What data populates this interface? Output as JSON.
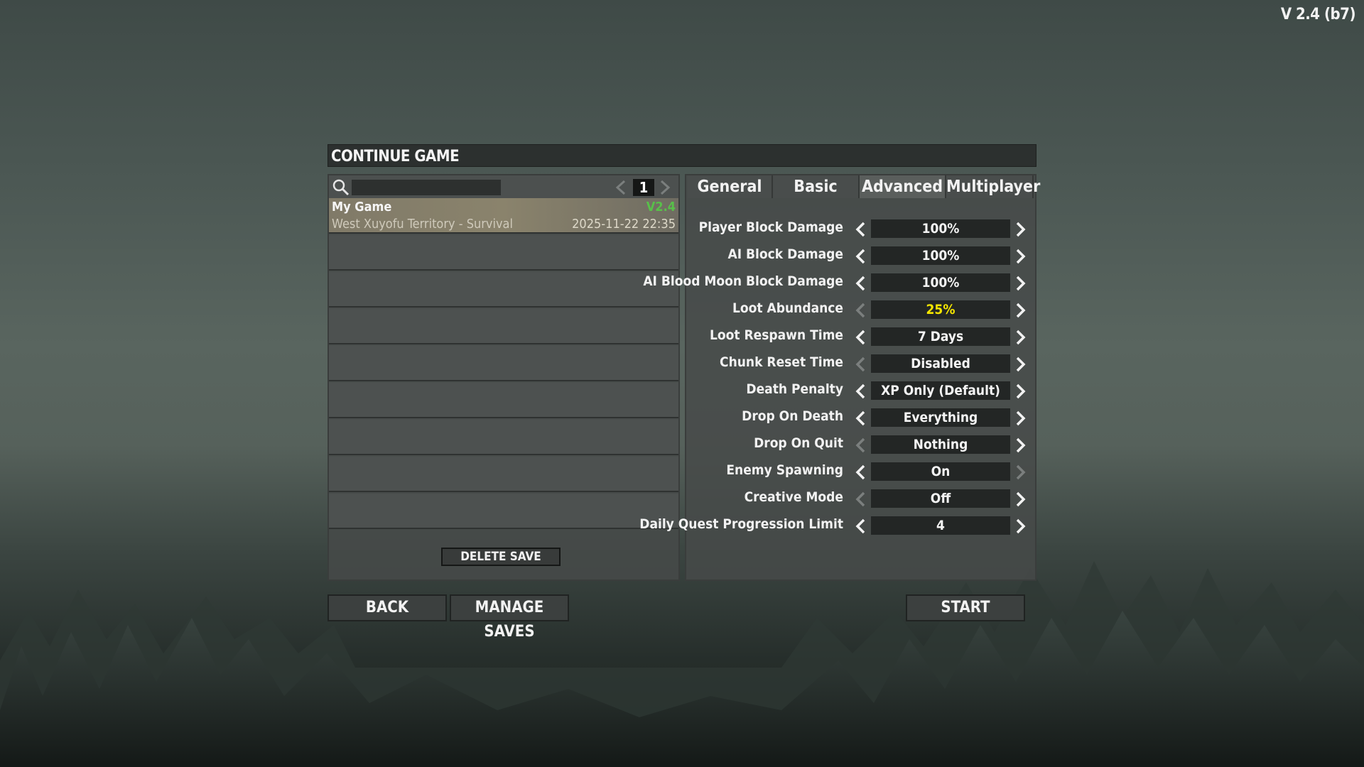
{
  "version": "V 2.4 (b7)",
  "dialog": {
    "title": "CONTINUE GAME"
  },
  "saves": {
    "page": "1",
    "items": [
      {
        "name": "My Game",
        "version": "V2.4",
        "world": "West Xuyofu Territory - Survival",
        "date": "2025-11-22 22:35"
      }
    ],
    "delete_label": "DELETE SAVE"
  },
  "tabs": [
    {
      "label": "General"
    },
    {
      "label": "Basic"
    },
    {
      "label": "Advanced",
      "active": true
    },
    {
      "label": "Multiplayer"
    }
  ],
  "settings": [
    {
      "label": "Player Block Damage",
      "value": "100%",
      "left_enabled": true,
      "right_enabled": true
    },
    {
      "label": "AI Block Damage",
      "value": "100%",
      "left_enabled": true,
      "right_enabled": true
    },
    {
      "label": "AI Blood Moon Block Damage",
      "value": "100%",
      "left_enabled": true,
      "right_enabled": true
    },
    {
      "label": "Loot Abundance",
      "value": "25%",
      "left_enabled": false,
      "right_enabled": true,
      "highlight": true
    },
    {
      "label": "Loot Respawn Time",
      "value": "7 Days",
      "left_enabled": true,
      "right_enabled": true
    },
    {
      "label": "Chunk Reset Time",
      "value": "Disabled",
      "left_enabled": false,
      "right_enabled": true
    },
    {
      "label": "Death Penalty",
      "value": "XP Only (Default)",
      "left_enabled": true,
      "right_enabled": true
    },
    {
      "label": "Drop On Death",
      "value": "Everything",
      "left_enabled": true,
      "right_enabled": true
    },
    {
      "label": "Drop On Quit",
      "value": "Nothing",
      "left_enabled": false,
      "right_enabled": true
    },
    {
      "label": "Enemy Spawning",
      "value": "On",
      "left_enabled": true,
      "right_enabled": false
    },
    {
      "label": "Creative Mode",
      "value": "Off",
      "left_enabled": false,
      "right_enabled": true
    },
    {
      "label": "Daily Quest Progression Limit",
      "value": "4",
      "left_enabled": true,
      "right_enabled": true
    }
  ],
  "buttons": {
    "back": "BACK",
    "manage_saves": "MANAGE SAVES",
    "start": "START"
  },
  "colors": {
    "highlight_value": "#f5e600",
    "version_text": "#58c04a",
    "selected_row": "#8a836c"
  }
}
